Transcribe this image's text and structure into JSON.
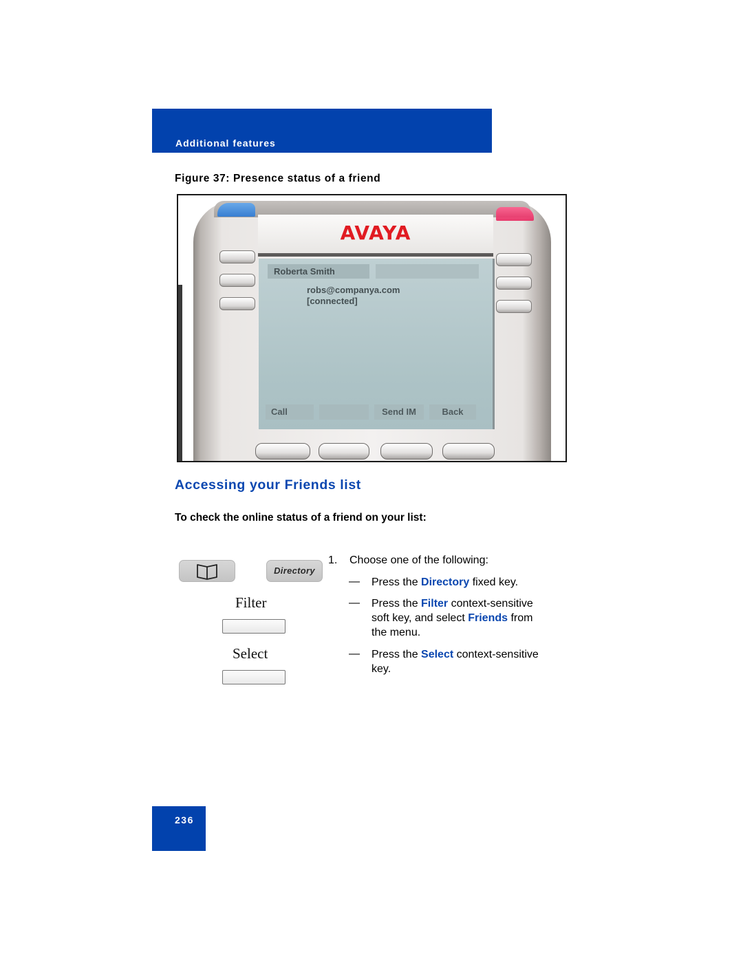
{
  "header": {
    "section_label": "Additional features",
    "band_color": "#0242ad"
  },
  "figure": {
    "caption": "Figure 37: Presence status of a friend",
    "phone": {
      "brand_logo": "AVAYA",
      "screen": {
        "title": "Roberta Smith",
        "email": "robs@companya.com",
        "status": "[connected]",
        "soft_labels": [
          "Call",
          "",
          "Send IM",
          "Back"
        ]
      },
      "led_colors": {
        "left": "#2a79d6",
        "right": "#e8275f"
      }
    }
  },
  "section": {
    "heading": "Accessing your Friends list",
    "heading_color": "#0b47b0",
    "procedure_intro": "To check the online status of a friend on your list:"
  },
  "keys": {
    "directory_icon": "open-book-icon",
    "directory_label": "Directory",
    "filter_label": "Filter",
    "select_label": "Select"
  },
  "steps": [
    {
      "number": "1.",
      "text": "Choose one of the following:",
      "options": [
        {
          "dash": "—",
          "before": "Press the ",
          "keyword": "Directory",
          "after": " fixed key."
        },
        {
          "dash": "—",
          "before": "Press the ",
          "keyword": "Filter",
          "after": " context-sensitive",
          "line2_before": "soft key, and select ",
          "line2_keyword": "Friends",
          "line2_after": " from",
          "line3": "the menu."
        },
        {
          "dash": "—",
          "before": "Press the ",
          "keyword": "Select",
          "after": " context-sensitive",
          "line2": "key."
        }
      ]
    }
  ],
  "footer": {
    "page_number": "236"
  }
}
